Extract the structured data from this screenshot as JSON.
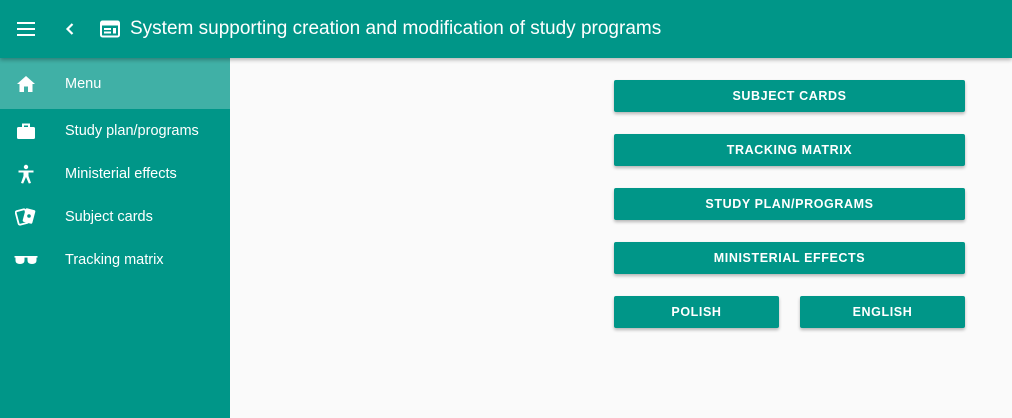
{
  "app": {
    "title": "System supporting creation and modification of study programs"
  },
  "toolbar": {
    "menu_icon": "menu-icon",
    "back_icon": "chevron-left-icon",
    "window_icon": "web-window-icon"
  },
  "sidebar": {
    "items": [
      {
        "label": "Menu",
        "icon": "home-icon",
        "active": true
      },
      {
        "label": "Study plan/programs",
        "icon": "briefcase-icon",
        "active": false
      },
      {
        "label": "Ministerial effects",
        "icon": "accessibility-icon",
        "active": false
      },
      {
        "label": "Subject cards",
        "icon": "cards-icon",
        "active": false
      },
      {
        "label": "Tracking matrix",
        "icon": "sunglasses-icon",
        "active": false
      }
    ]
  },
  "main": {
    "buttons": {
      "subject_cards": "SUBJECT CARDS",
      "tracking_matrix": "TRACKING MATRIX",
      "study_plan": "STUDY PLAN/PROGRAMS",
      "ministerial_effects": "MINISTERIAL EFFECTS",
      "polish": "POLISH",
      "english": "ENGLISH"
    }
  },
  "colors": {
    "primary": "#009688",
    "background": "#fafafa",
    "text_on_primary": "#ffffff"
  }
}
